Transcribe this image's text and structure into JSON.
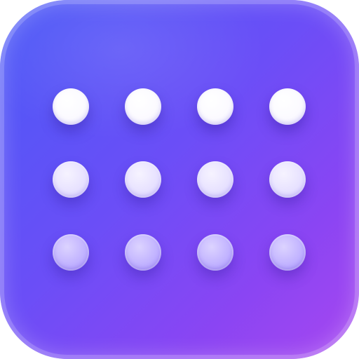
{
  "icon": {
    "name": "dot-grid-app-icon",
    "shape": "rounded-square",
    "gradient_colors": [
      "#4a5af7",
      "#6b4ef7",
      "#8a45f3",
      "#a847f0"
    ]
  },
  "dot_grid": {
    "rows": 3,
    "columns": 4,
    "row_colors": [
      "#ffffff",
      "#e6e0ff",
      "#bfb0ff"
    ]
  }
}
